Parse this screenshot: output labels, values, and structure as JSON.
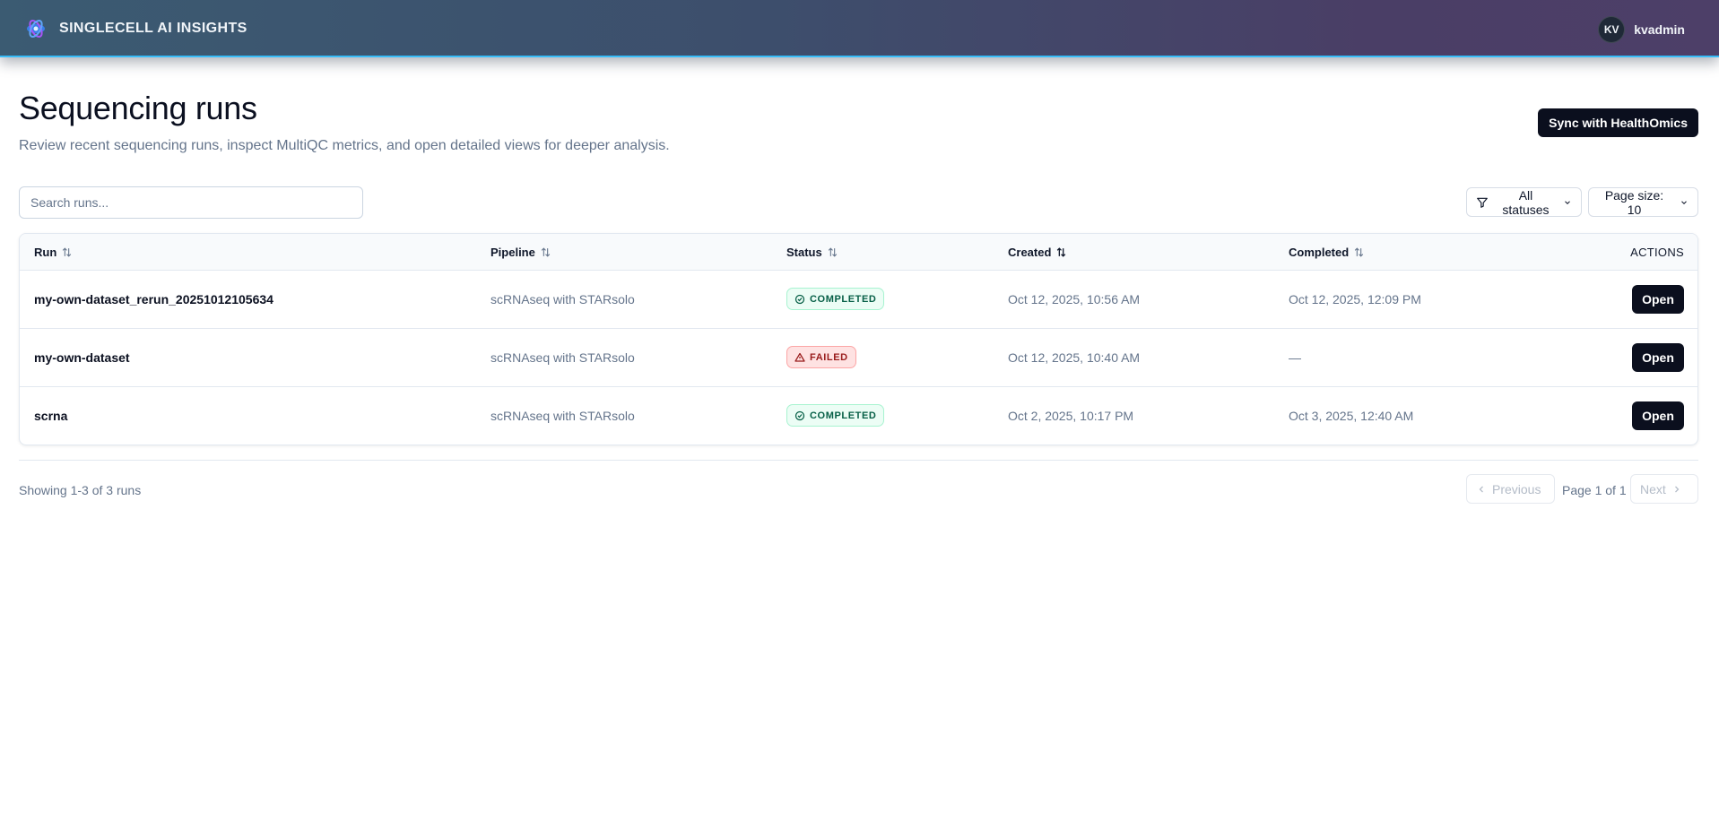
{
  "app": {
    "brand_name": "SINGLECELL AI INSIGHTS",
    "logo_icon": "dna-logo-icon",
    "accent": "#38bdf8"
  },
  "user": {
    "initials": "KV",
    "username": "kvadmin"
  },
  "page": {
    "title": "Sequencing runs",
    "subtitle": "Review recent sequencing runs, inspect MultiQC metrics, and open detailed views for deeper analysis.",
    "sync_label": "Sync with HealthOmics"
  },
  "toolbar": {
    "search_placeholder": "Search runs...",
    "search_value": "",
    "status_filter_label": "All statuses",
    "page_size_label": "Page size: 10"
  },
  "table": {
    "columns": {
      "run": "Run",
      "pipeline": "Pipeline",
      "status": "Status",
      "created": "Created",
      "completed": "Completed",
      "actions": "ACTIONS"
    },
    "rows": [
      {
        "run": "my-own-dataset_rerun_20251012105634",
        "pipeline": "scRNAseq with STARsolo",
        "status": "COMPLETED",
        "created": "Oct 12, 2025, 10:56 AM",
        "completed": "Oct 12, 2025, 12:09 PM",
        "action": "Open"
      },
      {
        "run": "my-own-dataset",
        "pipeline": "scRNAseq with STARsolo",
        "status": "FAILED",
        "created": "Oct 12, 2025, 10:40 AM",
        "completed": "—",
        "action": "Open"
      },
      {
        "run": "scrna",
        "pipeline": "scRNAseq with STARsolo",
        "status": "COMPLETED",
        "created": "Oct 2, 2025, 10:17 PM",
        "completed": "Oct 3, 2025, 12:40 AM",
        "action": "Open"
      }
    ],
    "status_colors": {
      "COMPLETED": "#065f46",
      "FAILED": "#991b1b"
    }
  },
  "footer": {
    "showing": "Showing 1-3 of 3 runs",
    "previous": "Previous",
    "page_info": "Page 1 of 1",
    "next": "Next"
  }
}
